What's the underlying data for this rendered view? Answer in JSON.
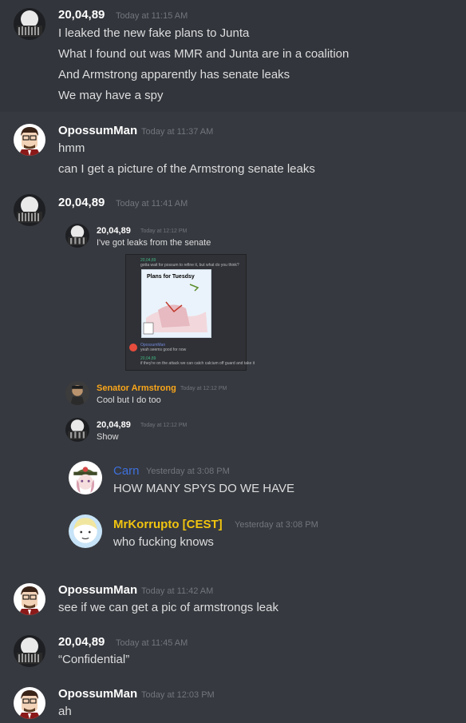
{
  "messages": [
    {
      "author": "20,04,89",
      "timestamp": "Today at 11:15 AM",
      "lines": [
        "I leaked the new fake plans to Junta",
        "What I found out was MMR and Junta are in a coalition",
        "And Armstrong apparently has senate leaks",
        "We may have a spy"
      ]
    },
    {
      "author": "OpossumMan",
      "timestamp": "Today at 11:37 AM",
      "lines": [
        "hmm",
        "can I get a picture of the Armstrong senate leaks"
      ]
    },
    {
      "author": "20,04,89",
      "timestamp": "Today at 11:41 AM",
      "lines": []
    },
    {
      "author": "OpossumMan",
      "timestamp": "Today at 11:42 AM",
      "lines": [
        "see if we can get a pic of armstrongs leak"
      ]
    },
    {
      "author": "20,04,89",
      "timestamp": "Today at 11:45 AM",
      "lines": [
        "“Confidential”"
      ]
    },
    {
      "author": "OpossumMan",
      "timestamp": "Today at 12:03 PM",
      "lines": [
        "ah"
      ]
    }
  ],
  "screenshot": {
    "messages": [
      {
        "author": "20,04,89",
        "timestamp": "Today at 12:12 PM",
        "lines": [
          "I've got leaks from the senate"
        ]
      },
      {
        "author": "Senator Armstrong",
        "timestamp": "Today at 12:12 PM",
        "lines": [
          "Cool but I do too"
        ],
        "color": "#faa61a"
      },
      {
        "author": "20,04,89",
        "timestamp": "Today at 12:12 PM",
        "lines": [
          "Show"
        ]
      }
    ],
    "image": {
      "plan_title": "Plans for Tuesdsy",
      "first_line": "gotta wait for possum to refine it, but what do you think?",
      "reply_line": "yeah seems good for now",
      "last_line": "if they're on the attack we can catch calcium off guard and take it"
    }
  },
  "nested": {
    "messages": [
      {
        "author": "Carn",
        "timestamp": "Yesterday at 3:08 PM",
        "lines": [
          "HOW MANY SPYS DO WE HAVE"
        ],
        "color": "#3e70dd"
      },
      {
        "author": "MrKorrupto [CEST]",
        "timestamp": "Yesterday at 3:08 PM",
        "lines": [
          "who fucking knows"
        ],
        "color": "#f1c40f"
      }
    ]
  },
  "colors": {
    "background": "#36393f",
    "text": "#dcddde",
    "timestamp": "#72767d"
  }
}
